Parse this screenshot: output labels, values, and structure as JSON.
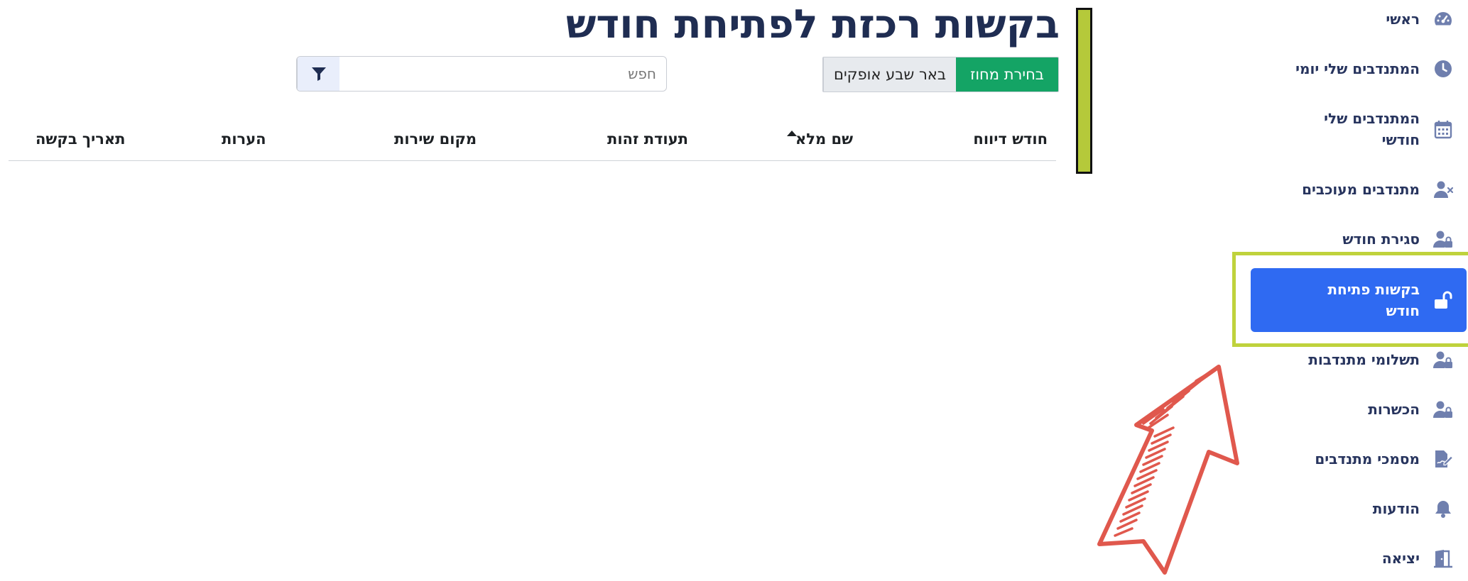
{
  "page": {
    "title": "בקשות רכזת לפתיחת חודש"
  },
  "sidebar": {
    "items": [
      {
        "label": "ראשי",
        "icon": "dashboard-icon"
      },
      {
        "label": "המתנדבים שלי יומי",
        "icon": "clock-icon"
      },
      {
        "label": "המתנדבים שלי חודשי",
        "icon": "calendar-icon"
      },
      {
        "label": "מתנדבים מעוכבים",
        "icon": "user-x-icon"
      },
      {
        "label": "סגירת חודש",
        "icon": "user-lock-icon"
      },
      {
        "label": "בקשות פתיחת חודש",
        "icon": "unlock-icon",
        "active": true
      },
      {
        "label": "תשלומי מתנדבות",
        "icon": "user-lock-icon"
      },
      {
        "label": "הכשרות",
        "icon": "user-lock-icon"
      },
      {
        "label": "מסמכי מתנדבים",
        "icon": "file-signature-icon"
      },
      {
        "label": "הודעות",
        "icon": "bell-icon"
      },
      {
        "label": "יציאה",
        "icon": "door-exit-icon"
      }
    ]
  },
  "toolbar": {
    "district_select_label": "בחירת מחוז",
    "district_value_label": "באר שבע אופקים",
    "search_placeholder": "חפש"
  },
  "table": {
    "columns": [
      "חודש דיווח",
      "שם מלא",
      "תעודת זהות",
      "מקום שירות",
      "הערות",
      "תאריך בקשה"
    ],
    "sorted_column": "שם מלא",
    "sort_direction": "ascending",
    "rows": []
  },
  "colors": {
    "primary_navy": "#1f2d52",
    "active_blue": "#2f6af2",
    "toggle_green": "#14a465",
    "highlight_yellow_green": "#bfd23c",
    "annotation_red": "#e0584d"
  }
}
